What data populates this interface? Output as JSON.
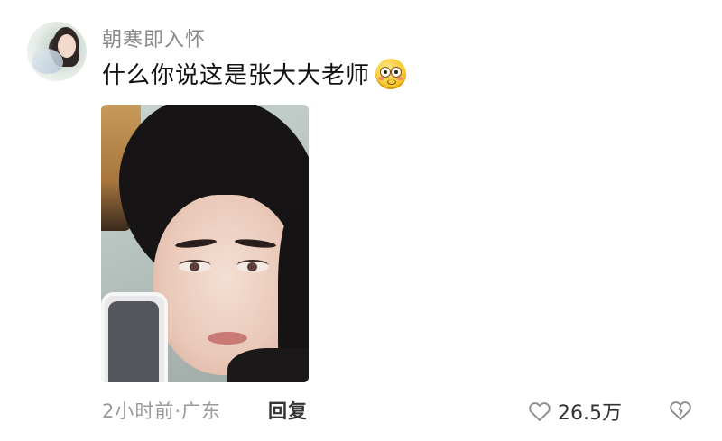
{
  "comment": {
    "username": "朝寒即入怀",
    "text": "什么你说这是张大大老师",
    "emoji": "smiling-face-emoji",
    "time_location": "2小时前·广东",
    "reply_label": "回复",
    "like_count": "26.5万"
  },
  "icons": {
    "like": "heart-outline-icon",
    "dislike": "broken-heart-icon"
  },
  "colors": {
    "username": "#8a8a8a",
    "text": "#111111",
    "meta": "#9a9a9a",
    "reply": "#333333"
  }
}
